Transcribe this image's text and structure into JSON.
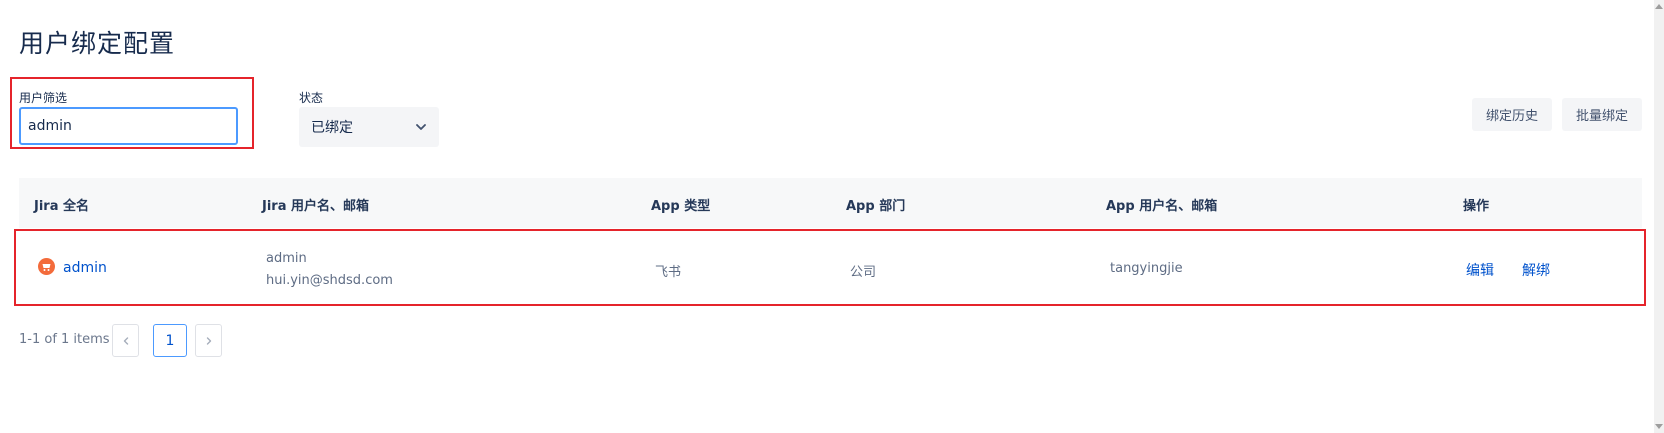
{
  "page": {
    "title": "用户绑定配置"
  },
  "filters": {
    "user_label": "用户筛选",
    "user_value": "admin",
    "status_label": "状态",
    "status_value": "已绑定"
  },
  "actions": {
    "history": "绑定历史",
    "batch": "批量绑定"
  },
  "table": {
    "columns": [
      "Jira 全名",
      "Jira 用户名、邮箱",
      "App 类型",
      "App 部门",
      "App 用户名、邮箱",
      "操作"
    ],
    "rows": [
      {
        "jira_fullname": "admin",
        "jira_username": "admin",
        "jira_email": "hui.yin@shdsd.com",
        "app_type": "飞书",
        "app_dept": "公司",
        "app_username": "tangyingjie",
        "edit": "编辑",
        "unbind": "解绑"
      }
    ]
  },
  "pagination": {
    "summary": "1-1 of 1 items",
    "current_page": "1"
  },
  "icons": {
    "avatar": "avatar-icon",
    "chevron": "chevron-down-icon",
    "prev": "chevron-left-icon",
    "next": "chevron-right-icon"
  },
  "colors": {
    "accent": "#0052cc",
    "highlight": "#e5242b",
    "avatar": "#f36b3b"
  }
}
